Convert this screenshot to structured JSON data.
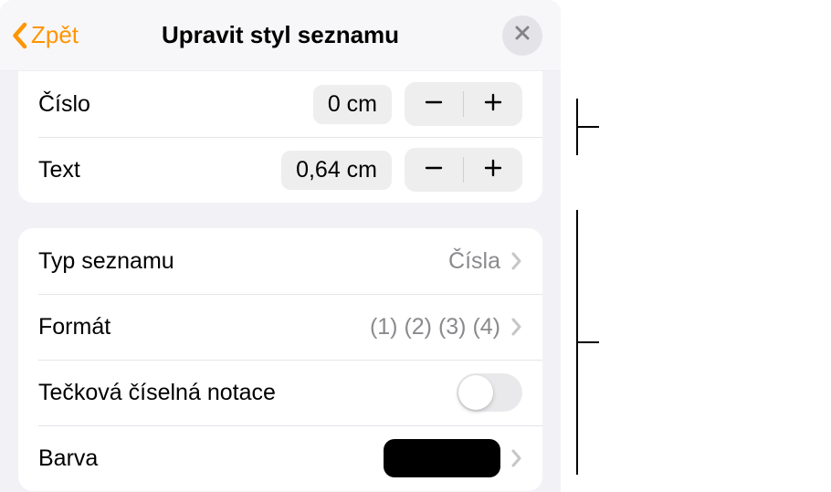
{
  "header": {
    "back_label": "Zpět",
    "title": "Upravit styl seznamu"
  },
  "indent": {
    "number_label": "Číslo",
    "number_value": "0 cm",
    "text_label": "Text",
    "text_value": "0,64 cm"
  },
  "list": {
    "type_label": "Typ seznamu",
    "type_value": "Čísla",
    "format_label": "Formát",
    "format_value": "(1) (2) (3) (4)",
    "tiered_label": "Tečková číselná notace",
    "color_label": "Barva",
    "color_value": "#000000"
  }
}
